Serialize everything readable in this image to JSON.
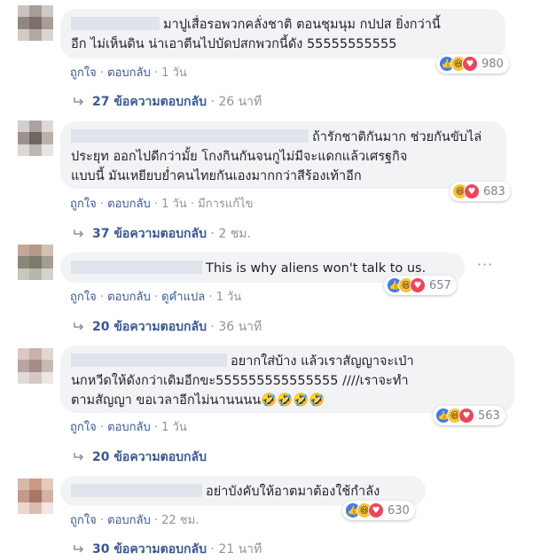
{
  "comments": [
    {
      "text": "มาปูเสื่อรอพวกคลั่งชาติ ตอนชุมนุม กปปส ยิ่งกว่านี้\nอีก ไม่เห็นดิน น่าเอาตีนไปบัดปสกพวกนี้ดัง 55555555555",
      "reaction_count": "980",
      "actions": {
        "like": "ถูกใจ",
        "reply": "ตอบกลับ",
        "time": "1 วัน"
      },
      "replies": {
        "label": "27 ข้อความตอบกลับ",
        "time": "26 นาที"
      }
    },
    {
      "text": "ถ้ารักชาติกันมาก ช่วยกันขับไล่\nประยุท ออกไปดีกว่ามั้ย โกงกินกันจนกูไม่มีจะแดกแล้วเศรฐกิจ\nแบบนี้ มันเหยียบย่ำคนไทยกันเองมากกว่าสีร้องเท้าอีก",
      "reaction_count": "683",
      "actions": {
        "like": "ถูกใจ",
        "reply": "ตอบกลับ",
        "time": "1 วัน",
        "edited": "มีการแก้ไข"
      },
      "replies": {
        "label": "37 ข้อความตอบกลับ",
        "time": "2 ชม."
      }
    },
    {
      "text": "This is why aliens won't talk to us.",
      "reaction_count": "657",
      "actions": {
        "like": "ถูกใจ",
        "reply": "ตอบกลับ",
        "translate": "ดูคำแปล",
        "time": "1 วัน"
      },
      "replies": {
        "label": "20 ข้อความตอบกลับ",
        "time": "36 นาที"
      }
    },
    {
      "text": "อยากใส่บ้าง แล้วเราสัญญาจะเป่า\nนกหวีดให้ดังกว่าเดิมอีกขะ555555555555555 ////เราจะทำ\nตามสัญญา ขอเวลาอีกไม่นานนนน🤣🤣🤣🤣",
      "reaction_count": "563",
      "actions": {
        "like": "ถูกใจ",
        "reply": "ตอบกลับ",
        "time": "1 วัน"
      },
      "replies": {
        "label": "20 ข้อความตอบกลับ"
      }
    },
    {
      "text": "อย่าบังคับให้อาตมาต้องใช้กำลัง",
      "reaction_count": "630",
      "actions": {
        "like": "ถูกใจ",
        "reply": "ตอบกลับ",
        "time": "22 ชม."
      },
      "replies": {
        "label": "30 ข้อความตอบกลับ",
        "time": "21 นาที"
      }
    }
  ],
  "menu_icon": "more-options-icon",
  "colors": {
    "bubble": "#f2f3f5",
    "link": "#385898",
    "meta": "#8d949e",
    "like": "#3b7cf0",
    "haha": "#f7c23b",
    "love": "#f0435a"
  }
}
